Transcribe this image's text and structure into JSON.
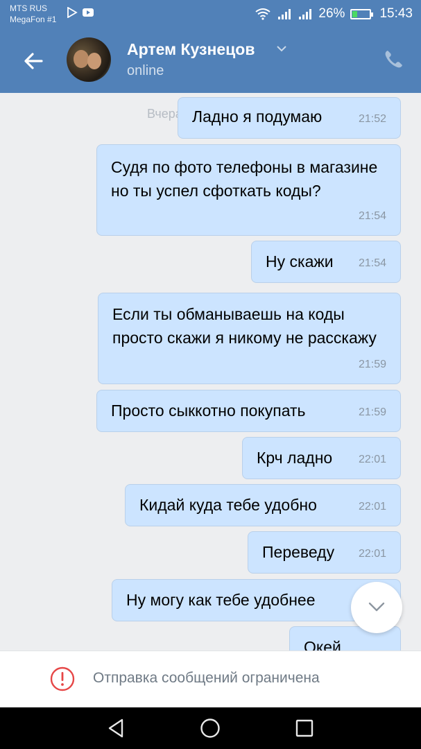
{
  "status_bar": {
    "carrier_1": "MTS RUS",
    "carrier_2": "MegaFon #1",
    "battery_percent": "26%",
    "time": "15:43"
  },
  "header": {
    "contact_name": "Артем Кузнецов",
    "contact_status": "online",
    "back_icon": "arrow-left-icon",
    "call_icon": "phone-icon"
  },
  "chat": {
    "date_separator": "Вчера",
    "messages": [
      {
        "text": "Ладно я подумаю",
        "time": "21:52"
      },
      {
        "text": "Судя по фото телефоны в магазине но ты успел сфоткать коды?",
        "time": "21:54"
      },
      {
        "text": "Ну скажи",
        "time": "21:54"
      },
      {
        "text": "Если ты обманываешь на коды просто скажи я никому не расскажу",
        "time": "21:59"
      },
      {
        "text": "Просто сыккотно покупать",
        "time": "21:59"
      },
      {
        "text": "Крч ладно",
        "time": "22:01"
      },
      {
        "text": "Кидай куда тебе удобно",
        "time": "22:01"
      },
      {
        "text": "Переведу",
        "time": "22:01"
      },
      {
        "text": "Ну могу как тебе удобнее",
        "time": ""
      },
      {
        "text": "Окей",
        "time": ""
      }
    ]
  },
  "restriction": {
    "text": "Отправка сообщений ограничена",
    "icon": "alert-icon"
  },
  "colors": {
    "header_blue": "#5181b8",
    "bubble": "#cce4ff",
    "chat_bg": "#edeef0",
    "alert_red": "#e64646"
  }
}
